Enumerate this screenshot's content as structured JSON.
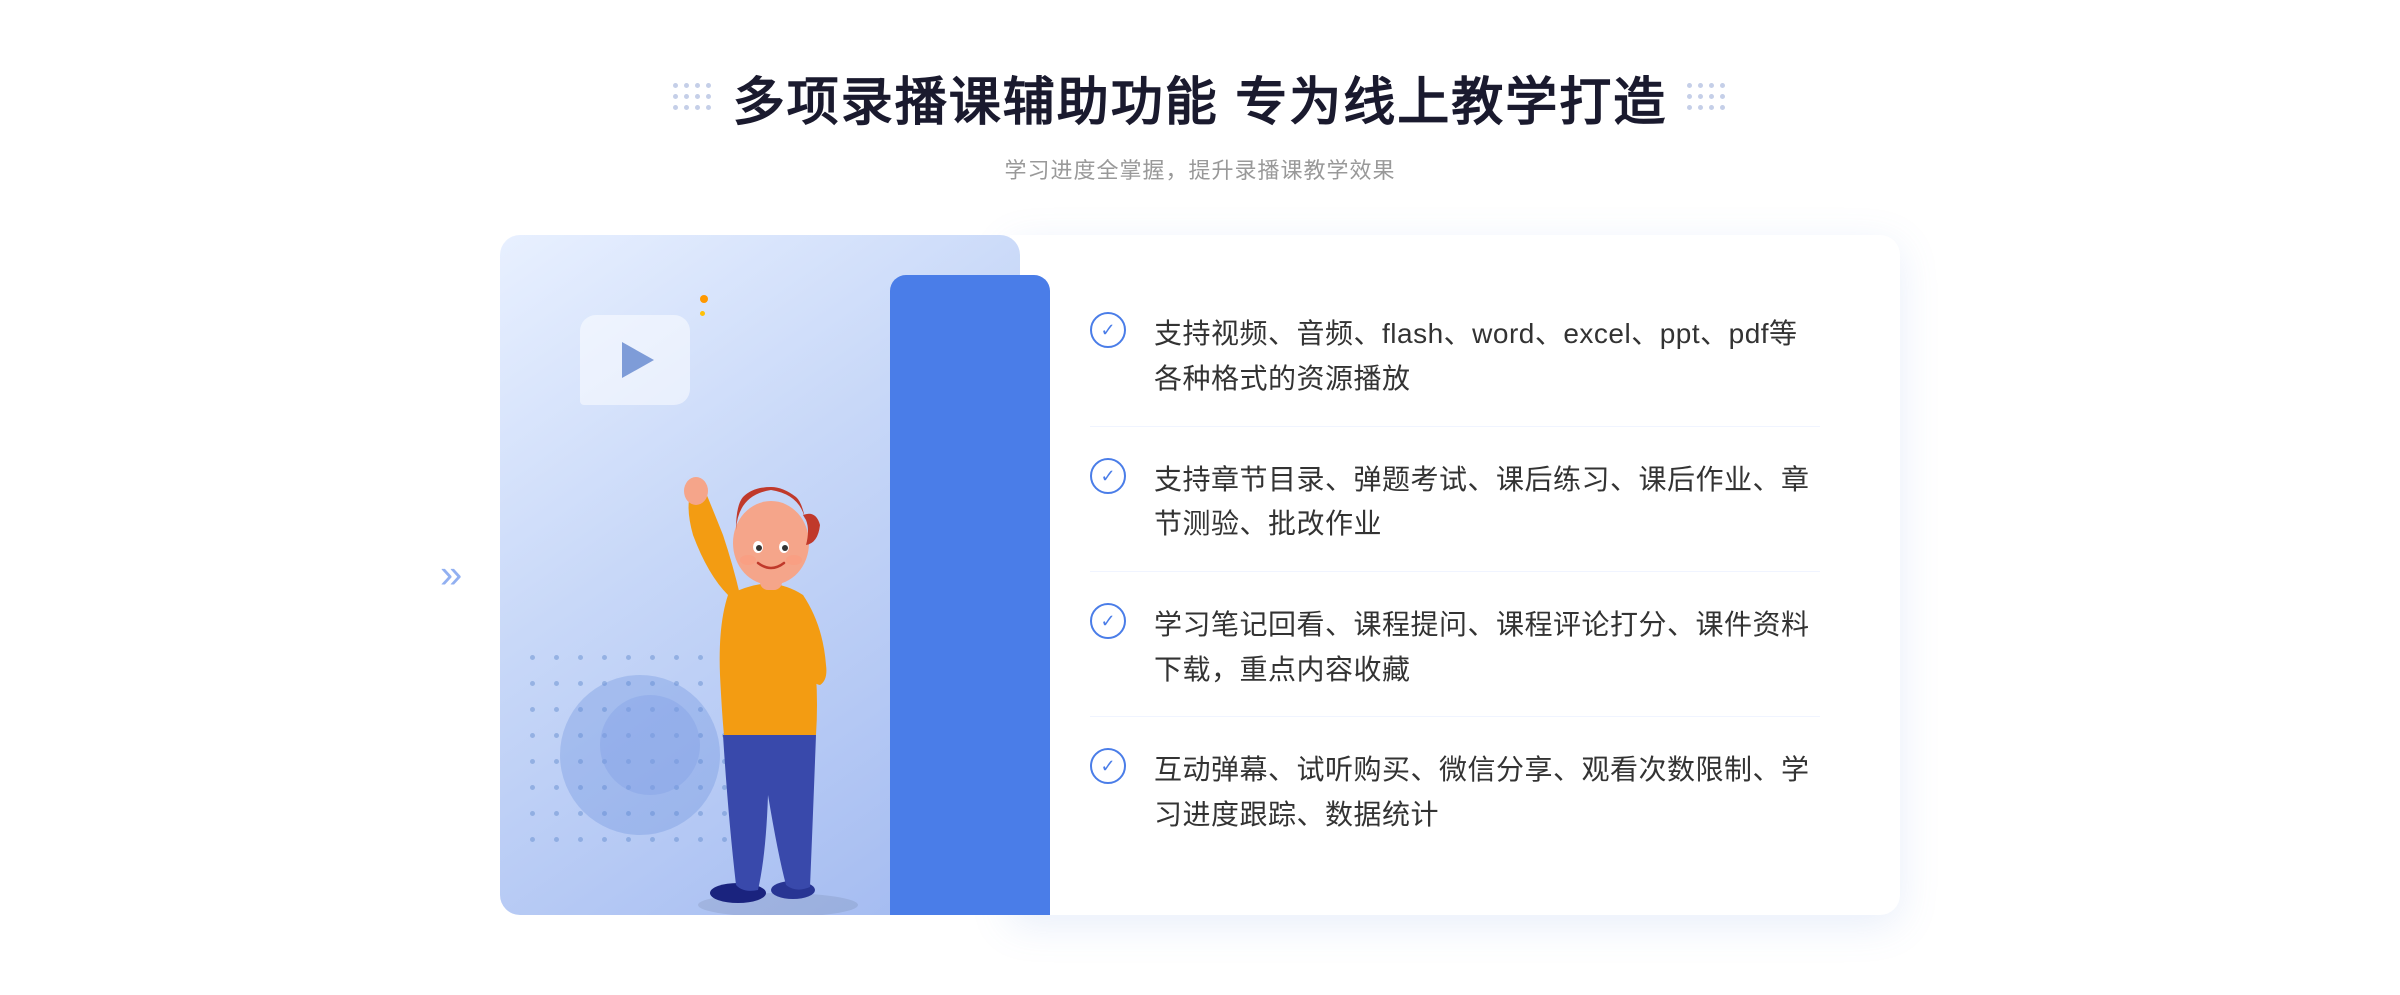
{
  "header": {
    "main_title": "多项录播课辅助功能 专为线上教学打造",
    "sub_title": "学习进度全掌握，提升录播课教学效果"
  },
  "features": [
    {
      "id": 1,
      "text": "支持视频、音频、flash、word、excel、ppt、pdf等各种格式的资源播放"
    },
    {
      "id": 2,
      "text": "支持章节目录、弹题考试、课后练习、课后作业、章节测验、批改作业"
    },
    {
      "id": 3,
      "text": "学习笔记回看、课程提问、课程评论打分、课件资料下载，重点内容收藏"
    },
    {
      "id": 4,
      "text": "互动弹幕、试听购买、微信分享、观看次数限制、学习进度跟踪、数据统计"
    }
  ],
  "icons": {
    "check": "✓",
    "chevron_right": "»",
    "play": "▶"
  },
  "colors": {
    "primary": "#4a7de8",
    "title": "#1a1a2e",
    "subtitle": "#999999",
    "text": "#333333",
    "border": "#f0f4ff"
  }
}
